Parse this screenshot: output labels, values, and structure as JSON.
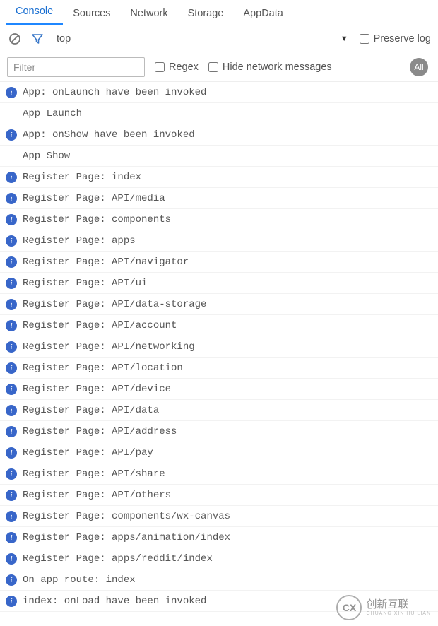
{
  "tabs": {
    "items": [
      "Console",
      "Sources",
      "Network",
      "Storage",
      "AppData"
    ],
    "activeIndex": 0
  },
  "toolbar": {
    "context": "top",
    "preserve_log_label": "Preserve log"
  },
  "filter": {
    "placeholder": "Filter",
    "regex_label": "Regex",
    "hide_net_label": "Hide network messages",
    "all_badge": "All"
  },
  "logs": [
    {
      "icon": true,
      "text": "App: onLaunch have been invoked"
    },
    {
      "icon": false,
      "text": "App Launch"
    },
    {
      "icon": true,
      "text": "App: onShow have been invoked"
    },
    {
      "icon": false,
      "text": "App Show"
    },
    {
      "icon": true,
      "text": "Register Page: index"
    },
    {
      "icon": true,
      "text": "Register Page: API/media"
    },
    {
      "icon": true,
      "text": "Register Page: components"
    },
    {
      "icon": true,
      "text": "Register Page: apps"
    },
    {
      "icon": true,
      "text": "Register Page: API/navigator"
    },
    {
      "icon": true,
      "text": "Register Page: API/ui"
    },
    {
      "icon": true,
      "text": "Register Page: API/data-storage"
    },
    {
      "icon": true,
      "text": "Register Page: API/account"
    },
    {
      "icon": true,
      "text": "Register Page: API/networking"
    },
    {
      "icon": true,
      "text": "Register Page: API/location"
    },
    {
      "icon": true,
      "text": "Register Page: API/device"
    },
    {
      "icon": true,
      "text": "Register Page: API/data"
    },
    {
      "icon": true,
      "text": "Register Page: API/address"
    },
    {
      "icon": true,
      "text": "Register Page: API/pay"
    },
    {
      "icon": true,
      "text": "Register Page: API/share"
    },
    {
      "icon": true,
      "text": "Register Page: API/others"
    },
    {
      "icon": true,
      "text": "Register Page: components/wx-canvas"
    },
    {
      "icon": true,
      "text": "Register Page: apps/animation/index"
    },
    {
      "icon": true,
      "text": "Register Page: apps/reddit/index"
    },
    {
      "icon": true,
      "text": "On app route: index"
    },
    {
      "icon": true,
      "text": "index: onLoad have been invoked"
    }
  ],
  "watermark": {
    "logo": "CX",
    "brand": "创新互联",
    "sub": "CHUANG XIN HU LIAN"
  }
}
